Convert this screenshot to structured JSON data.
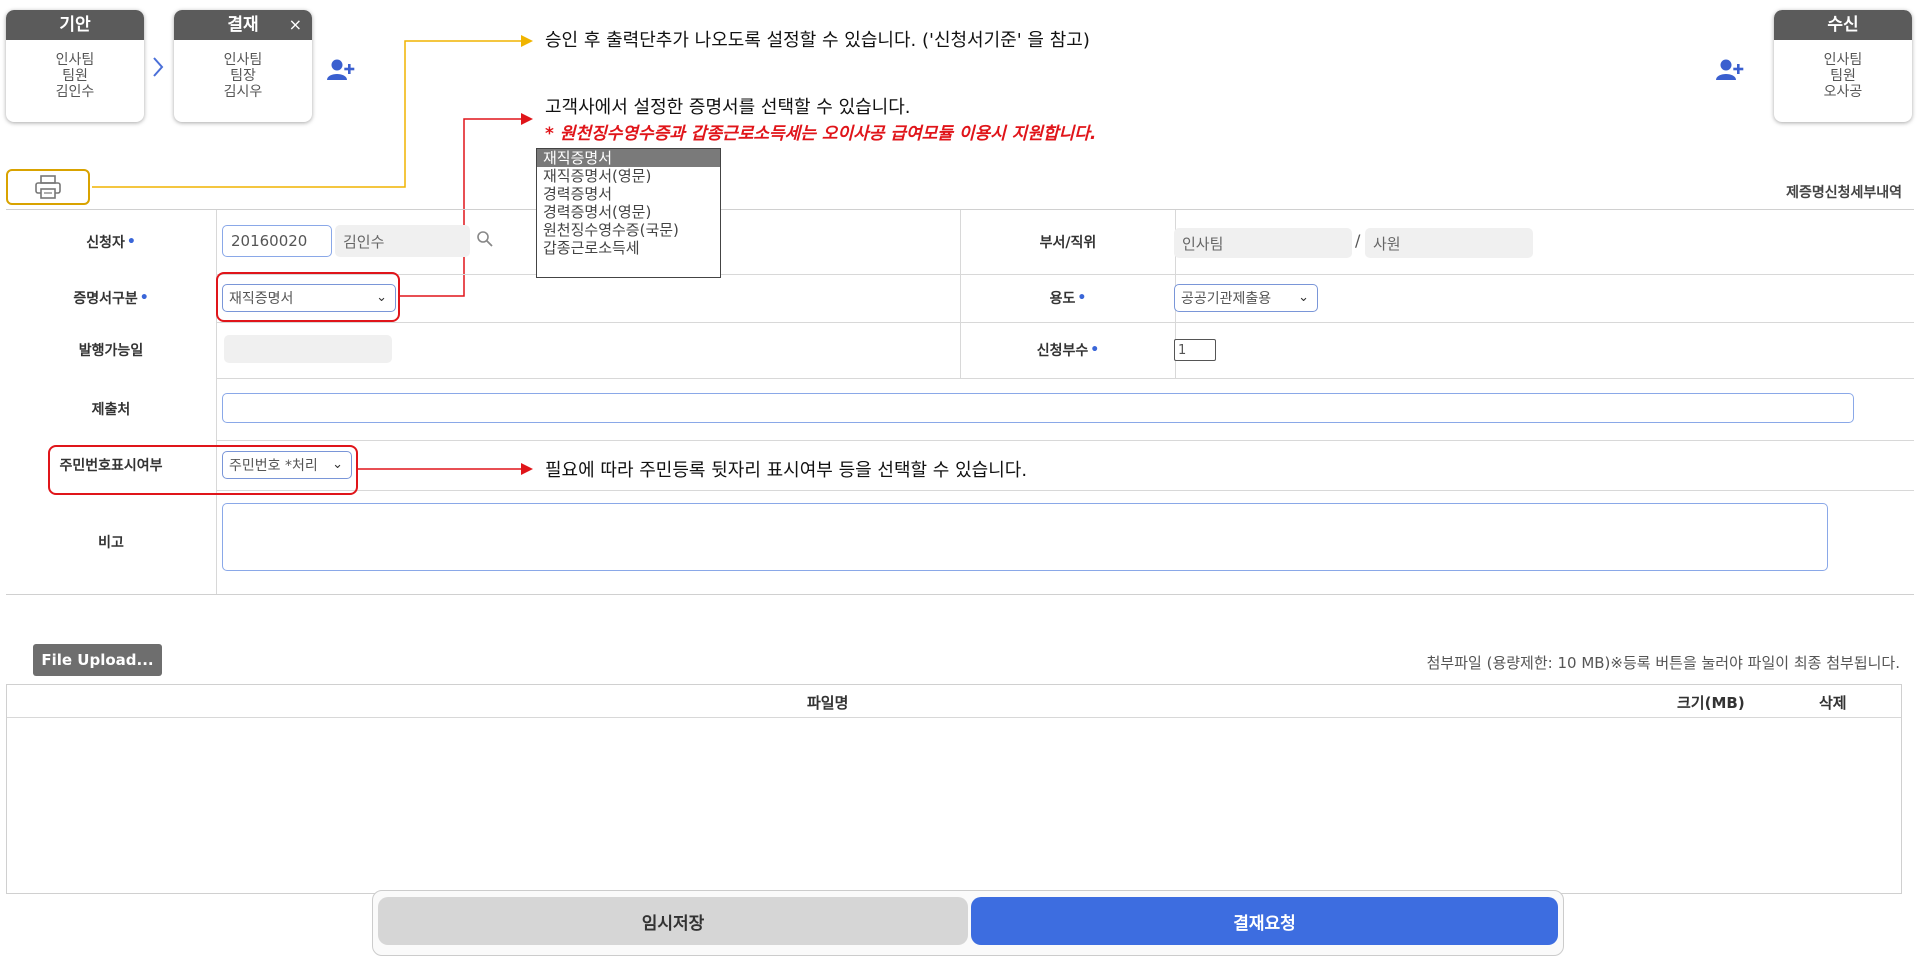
{
  "approval": {
    "draft": {
      "title": "기안",
      "lines": [
        "인사팀",
        "팀원",
        "김인수"
      ]
    },
    "approve": {
      "title": "결재",
      "close": "×",
      "lines": [
        "인사팀",
        "팀장",
        "김시우"
      ]
    },
    "receive": {
      "title": "수신",
      "lines": [
        "인사팀",
        "팀원",
        "오사공"
      ]
    }
  },
  "annotations": {
    "print": "승인 후 출력단추가 나오도록 설정할 수 있습니다. ('신청서기준' 을 참고)",
    "cert_line1": "고객사에서 설정한 증명서를 선택할 수 있습니다.",
    "cert_line2": "* 원천징수영수증과 갑종근로소득세는 오이사공 급여모듈 이용시 지원합니다.",
    "resident": "필요에 따라 주민등록 뒷자리 표시여부 등을 선택할 수 있습니다."
  },
  "cert_options": [
    "재직증명서",
    "재직증명서(영문)",
    "경력증명서",
    "경력증명서(영문)",
    "원천징수영수증(국문)",
    "갑종근로소득세"
  ],
  "section_title": "제증명신청세부내역",
  "form": {
    "applicant_label": "신청자",
    "applicant_id": "20160020",
    "applicant_name": "김인수",
    "dept_label": "부서/직위",
    "dept": "인사팀",
    "slash": "/",
    "position": "사원",
    "cert_type_label": "증명서구분",
    "cert_type_value": "재직증명서",
    "purpose_label": "용도",
    "purpose_value": "공공기관제출용",
    "issue_date_label": "발행가능일",
    "issue_date_value": "",
    "copies_label": "신청부수",
    "copies_value": "1",
    "submit_to_label": "제출처",
    "submit_to_value": "",
    "resident_label": "주민번호표시여부",
    "resident_value": "주민번호 *처리",
    "remark_label": "비고",
    "remark_value": "",
    "required_mark": "•"
  },
  "upload": {
    "button": "File Upload...",
    "note": "첨부파일 (용량제한: 10 MB)※등록 버튼을 눌러야 파일이 최종 첨부됩니다.",
    "col_name": "파일명",
    "col_size": "크기(MB)",
    "col_delete": "삭제"
  },
  "buttons": {
    "save": "임시저장",
    "submit": "결재요청"
  },
  "colors": {
    "accent": "#3d6de0",
    "annotation_red": "#e0151a",
    "annotation_yellow": "#f0b400",
    "card_header": "#5b5b5b"
  }
}
